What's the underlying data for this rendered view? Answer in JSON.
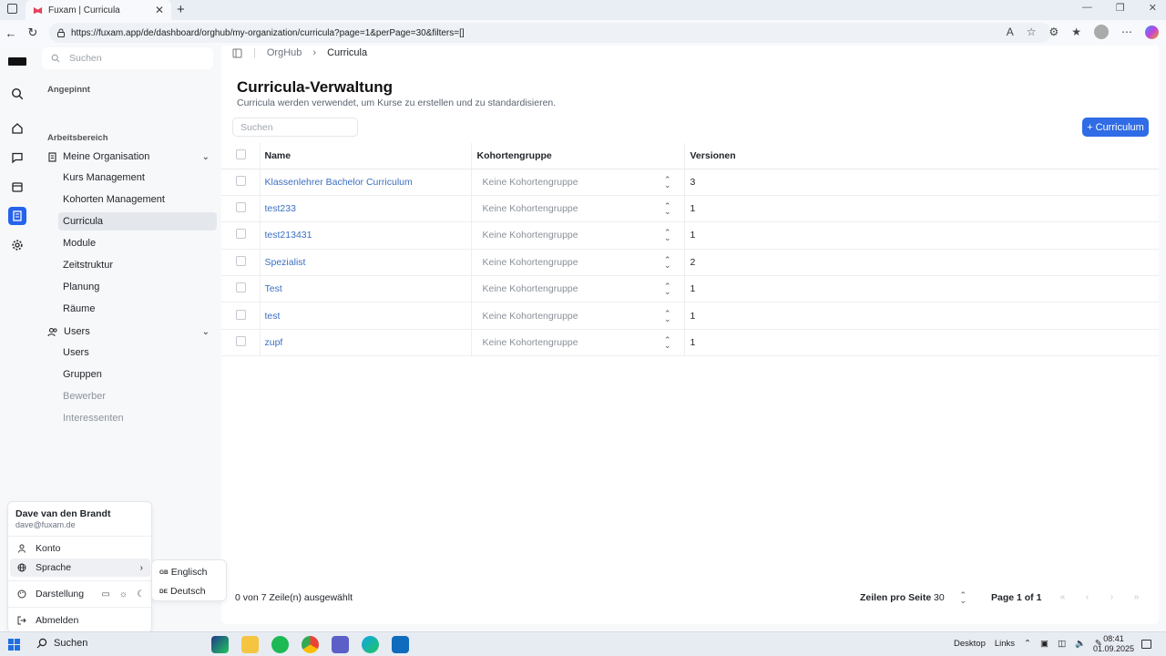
{
  "browser": {
    "tab_title": "Fuxam | Curricula",
    "url": "https://fuxam.app/de/dashboard/orghub/my-organization/curricula?page=1&perPage=30&filters=[]"
  },
  "sidebar": {
    "search_placeholder": "Suchen",
    "pinned_heading": "Angepinnt",
    "workspace_heading": "Arbeitsbereich",
    "group_org": "Meine Organisation",
    "org_items": [
      "Kurs Management",
      "Kohorten Management",
      "Curricula",
      "Module",
      "Zeitstruktur",
      "Planung",
      "Räume"
    ],
    "group_users": "Users",
    "user_items": [
      "Users",
      "Gruppen",
      "Bewerber",
      "Interessenten"
    ]
  },
  "main": {
    "breadcrumb": [
      "OrgHub",
      "Curricula"
    ],
    "title": "Curricula-Verwaltung",
    "subtitle": "Curricula werden verwendet, um Kurse zu erstellen und zu standardisieren.",
    "search_placeholder": "Suchen",
    "add_button": "Curriculum",
    "columns": [
      "Name",
      "Kohortengruppe",
      "Versionen"
    ],
    "rows": [
      {
        "name": "Klassenlehrer Bachelor Curriculum",
        "kohorte": "Keine Kohortengruppe",
        "versionen": "3"
      },
      {
        "name": "test233",
        "kohorte": "Keine Kohortengruppe",
        "versionen": "1"
      },
      {
        "name": "test213431",
        "kohorte": "Keine Kohortengruppe",
        "versionen": "1"
      },
      {
        "name": "Spezialist",
        "kohorte": "Keine Kohortengruppe",
        "versionen": "2"
      },
      {
        "name": "Test",
        "kohorte": "Keine Kohortengruppe",
        "versionen": "1"
      },
      {
        "name": "test",
        "kohorte": "Keine Kohortengruppe",
        "versionen": "1"
      },
      {
        "name": "zupf",
        "kohorte": "Keine Kohortengruppe",
        "versionen": "1"
      }
    ],
    "footer": {
      "selection": "0 von 7 Zeile(n) ausgewählt",
      "rows_per_page_label": "Zeilen pro Seite",
      "rows_per_page_value": "30",
      "page_info": "Page 1 of 1"
    }
  },
  "user_menu": {
    "name": "Dave van den Brandt",
    "email": "dave@fuxam.de",
    "konto": "Konto",
    "sprache": "Sprache",
    "darstellung": "Darstellung",
    "abmelden": "Abmelden",
    "languages": [
      {
        "code": "GB",
        "label": "Englisch"
      },
      {
        "code": "DE",
        "label": "Deutsch"
      }
    ]
  },
  "taskbar": {
    "search": "Suchen",
    "desktop": "Desktop",
    "links": "Links",
    "time": "08:41",
    "date": "01.09.2025"
  },
  "colors": {
    "accent": "#2f6ce5",
    "link": "#3b6fc4"
  }
}
